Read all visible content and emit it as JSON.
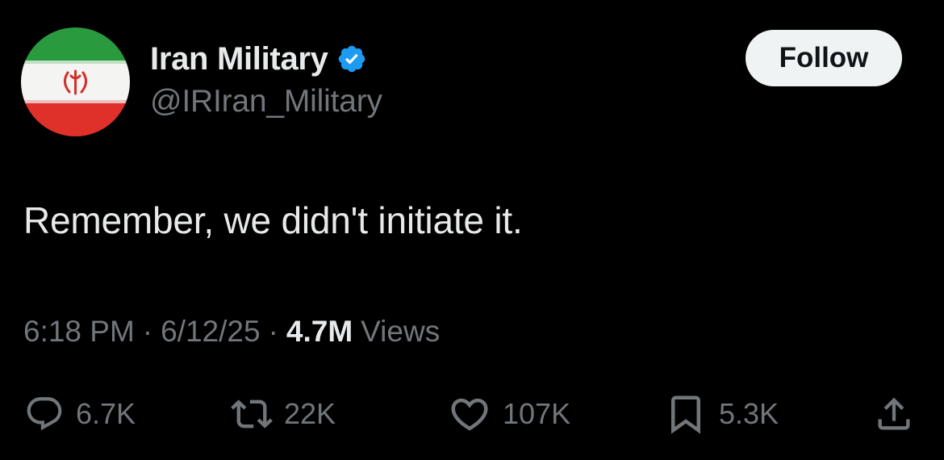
{
  "author": {
    "display_name": "Iran Military",
    "handle": "@IRIran_Military",
    "verified": true,
    "avatar_icon": "iran-flag",
    "verified_color": "#1d9bf0"
  },
  "follow_button": {
    "label": "Follow"
  },
  "tweet": {
    "text": "Remember, we didn't initiate it."
  },
  "meta": {
    "time": "6:18 PM",
    "separator": "·",
    "date": "6/12/25",
    "views_count": "4.7M",
    "views_label": "Views"
  },
  "actions": [
    {
      "icon": "reply-icon",
      "count": "6.7K"
    },
    {
      "icon": "repost-icon",
      "count": "22K"
    },
    {
      "icon": "like-icon",
      "count": "107K"
    },
    {
      "icon": "bookmark-icon",
      "count": "5.3K"
    },
    {
      "icon": "share-icon",
      "count": ""
    }
  ],
  "colors": {
    "background": "#000000",
    "primary_text": "#e7e9ea",
    "secondary_text": "#71767b",
    "button_bg": "#eff3f4"
  }
}
